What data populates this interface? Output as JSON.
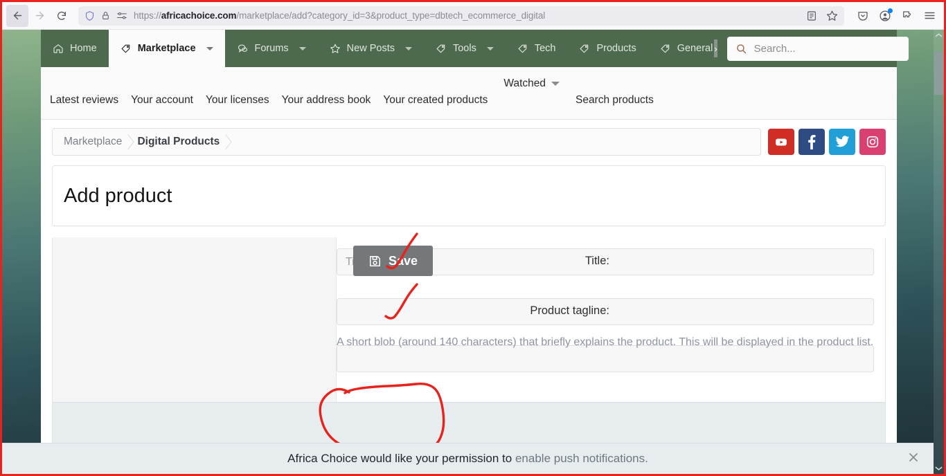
{
  "browser": {
    "url_prefix": "https://",
    "url_domain": "africachoice.com",
    "url_path": "/marketplace/add?category_id=3&product_type=dbtech_ecommerce_digital",
    "back_icon": "back-arrow-icon",
    "forward_icon": "forward-arrow-icon",
    "reload_icon": "reload-icon",
    "shield_icon": "shield-icon",
    "lock_icon": "lock-icon",
    "permissions_icon": "page-permissions-icon",
    "reader_icon": "reader-view-icon",
    "bookmark_icon": "bookmark-star-icon",
    "pocket_icon": "pocket-icon",
    "account_icon": "account-icon",
    "extensions_icon": "extensions-puzzle-icon",
    "menu_icon": "hamburger-menu-icon"
  },
  "navbar": {
    "items": [
      {
        "label": "Home",
        "icon": "home-icon",
        "has_caret": false,
        "active": false
      },
      {
        "label": "Marketplace",
        "icon": "tag-icon",
        "has_caret": true,
        "active": true
      },
      {
        "label": "Forums",
        "icon": "comments-icon",
        "has_caret": true,
        "active": false
      },
      {
        "label": "New Posts",
        "icon": "star-icon",
        "has_caret": true,
        "active": false
      },
      {
        "label": "Tools",
        "icon": "tag-icon",
        "has_caret": true,
        "active": false
      },
      {
        "label": "Tech",
        "icon": "tag-icon",
        "has_caret": false,
        "active": false
      },
      {
        "label": "Products",
        "icon": "tag-icon",
        "has_caret": false,
        "active": false
      },
      {
        "label": "General",
        "icon": "tag-icon",
        "has_caret": false,
        "active": false
      }
    ],
    "more_label": "›",
    "search_placeholder": "Search...",
    "search_icon": "search-icon",
    "bg_color": "#4e6a4e"
  },
  "subnav": {
    "items": [
      {
        "label": "Latest reviews"
      },
      {
        "label": "Your account"
      },
      {
        "label": "Your licenses"
      },
      {
        "label": "Your address book"
      },
      {
        "label": "Your created products"
      },
      {
        "label": "Watched",
        "has_caret": true,
        "raised": true
      },
      {
        "label": "Search products"
      }
    ]
  },
  "breadcrumb": {
    "items": [
      {
        "label": "Marketplace",
        "current": false
      },
      {
        "label": "Digital Products",
        "current": true
      }
    ]
  },
  "socials": [
    {
      "name": "youtube",
      "glyph": "▶",
      "color": "#d02d24"
    },
    {
      "name": "facebook",
      "glyph": "f",
      "color": "#2f4b84"
    },
    {
      "name": "twitter",
      "glyph": "❦",
      "color": "#21a0d8"
    },
    {
      "name": "instagram",
      "glyph": "▢",
      "color": "#d9406f"
    }
  ],
  "page": {
    "title": "Add product"
  },
  "form": {
    "title_label": "Title:",
    "title_placeholder": "Title...",
    "title_value": "",
    "tagline_label": "Product tagline:",
    "tagline_placeholder": "",
    "tagline_value": "",
    "tagline_hint": "A short blob (around 140 characters) that briefly explains the product. This will be displayed in the product list.",
    "save_label": "Save",
    "save_icon": "floppy-disk-save-icon",
    "save_color": "#74787a"
  },
  "annotations": {
    "color": "#e8221c",
    "marks": [
      {
        "name": "check-title-field",
        "type": "checkmark"
      },
      {
        "name": "check-tagline-field",
        "type": "checkmark"
      },
      {
        "name": "circle-save-button",
        "type": "circle"
      }
    ]
  },
  "push_notification": {
    "message_prefix": "Africa Choice would like your permission to ",
    "message_link": "enable push notifications.",
    "close_icon": "close-icon"
  },
  "scrollbar": {
    "up_icon": "chevron-up-icon",
    "down_icon": "chevron-down-icon"
  }
}
